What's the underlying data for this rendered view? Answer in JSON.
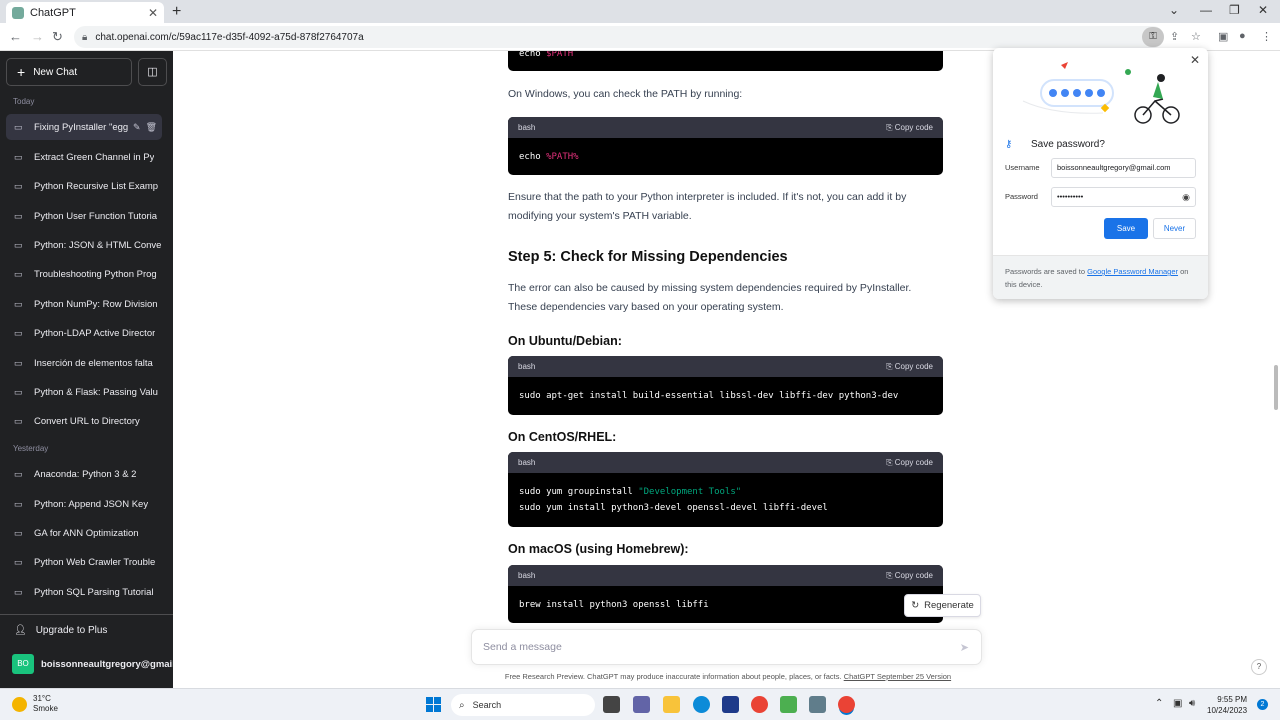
{
  "browser": {
    "tab_title": "ChatGPT",
    "new_tab": "+",
    "url": "chat.openai.com/c/59ac117e-d35f-4092-a75d-878f2764707a"
  },
  "sidebar": {
    "new_chat": "New Chat",
    "today_label": "Today",
    "yesterday_label": "Yesterday",
    "today_items": [
      {
        "label": "Fixing PyInstaller \"egg"
      },
      {
        "label": "Extract Green Channel in Py"
      },
      {
        "label": "Python Recursive List Examp"
      },
      {
        "label": "Python User Function Tutoria"
      },
      {
        "label": "Python: JSON & HTML Conve"
      },
      {
        "label": "Troubleshooting Python Prog"
      },
      {
        "label": "Python NumPy: Row Division"
      },
      {
        "label": "Python-LDAP Active Director"
      },
      {
        "label": "Inserción de elementos falta"
      },
      {
        "label": "Python & Flask: Passing Valu"
      },
      {
        "label": "Convert URL to Directory"
      }
    ],
    "yesterday_items": [
      {
        "label": "Anaconda: Python 3 & 2"
      },
      {
        "label": "Python: Append JSON Key"
      },
      {
        "label": "GA for ANN Optimization"
      },
      {
        "label": "Python Web Crawler Trouble"
      },
      {
        "label": "Python SQL Parsing Tutorial"
      }
    ],
    "upgrade": "Upgrade to Plus",
    "user_initials": "BO",
    "user_email": "boissonneaultgregory@gmail.com"
  },
  "main": {
    "code0": {
      "cmd": "echo ",
      "var": "$PATH"
    },
    "p_windows": "On Windows, you can check the PATH by running:",
    "code1": {
      "lang": "bash",
      "copy": "Copy code",
      "cmd": "echo ",
      "var": "%PATH%"
    },
    "p_ensure1": "Ensure that the path to your Python interpreter is included. If it's not, you can add it by",
    "p_ensure2": "modifying your system's PATH variable.",
    "step5": "Step 5: Check for Missing Dependencies",
    "p_error1": "The error can also be caused by missing system dependencies required by PyInstaller.",
    "p_error2": "These dependencies vary based on your operating system.",
    "ubuntu_h": "On Ubuntu/Debian:",
    "code2": {
      "lang": "bash",
      "copy": "Copy code",
      "line": "sudo apt-get install build-essential libssl-dev libffi-dev python3-dev"
    },
    "centos_h": "On CentOS/RHEL:",
    "code3": {
      "lang": "bash",
      "copy": "Copy code",
      "line1a": "sudo yum groupinstall ",
      "line1b": "\"Development Tools\"",
      "line2": "sudo yum install python3-devel openssl-devel libffi-devel"
    },
    "macos_h": "On macOS (using Homebrew):",
    "code4": {
      "lang": "bash",
      "copy": "Copy code",
      "line": "brew install python3 openssl libffi"
    },
    "regenerate": "Regenerate",
    "message_placeholder": "Send a message",
    "footnote": "Free Research Preview. ChatGPT may produce inaccurate information about people, places, or facts.",
    "footnote_link": "ChatGPT September 25 Version",
    "help": "?"
  },
  "password_popup": {
    "title": "Save password?",
    "username_label": "Username",
    "username_value": "boissonneaultgregory@gmail.com",
    "password_label": "Password",
    "password_value": "••••••••••",
    "save": "Save",
    "never": "Never",
    "footer_pre": "Passwords are saved to ",
    "footer_link": "Google Password Manager",
    "footer_post": " on this device."
  },
  "taskbar": {
    "temp": "31°C",
    "weather": "Smoke",
    "search": "Search",
    "time": "9:55 PM",
    "date": "10/24/2023",
    "notifications": "2"
  }
}
